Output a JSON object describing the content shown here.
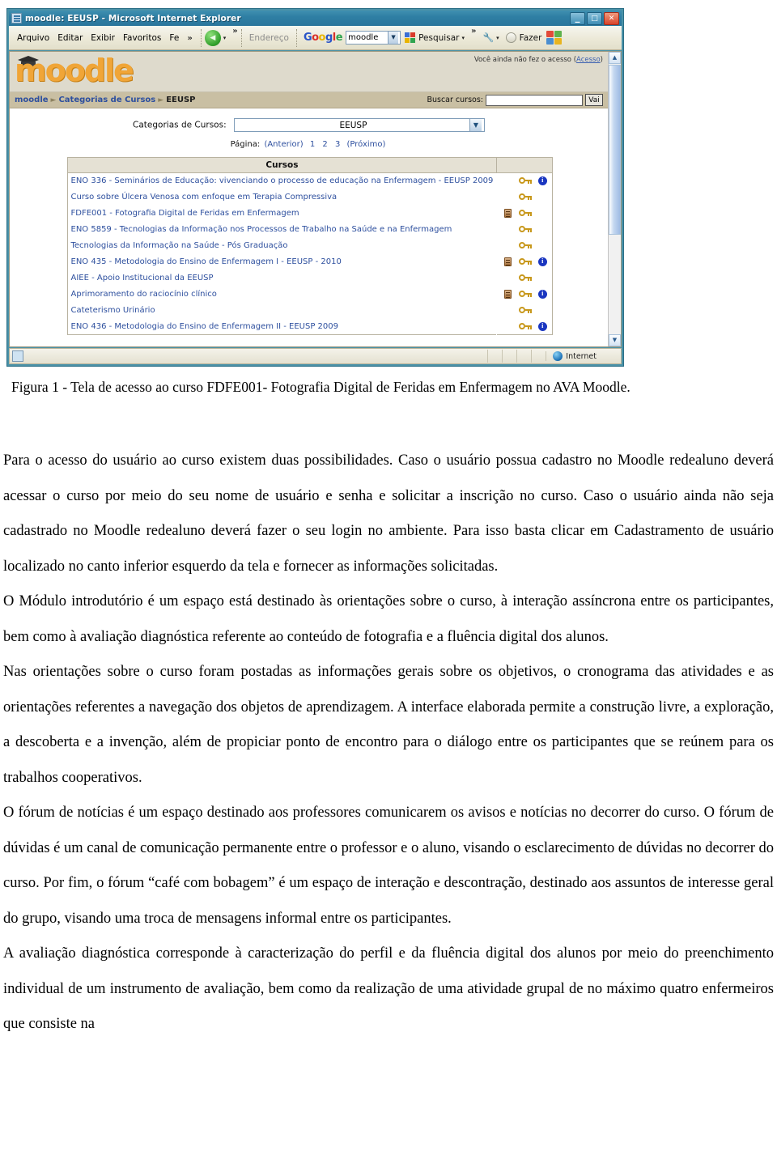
{
  "browser": {
    "window_title": "moodle: EEUSP - Microsoft Internet Explorer",
    "window_controls": {
      "minimize": "_",
      "maximize": "□",
      "close": "✕"
    },
    "menu_items": [
      "Arquivo",
      "Editar",
      "Exibir",
      "Favoritos",
      "Fe"
    ],
    "menu_overflow": "»",
    "nav_overflow": "»",
    "address_label": "Endereço",
    "google": {
      "logo": "Google",
      "query": "moodle",
      "search_label": "Pesquisar",
      "overflow": "»"
    },
    "tools_label": "Fazer",
    "status": {
      "zone": "Internet"
    }
  },
  "moodle": {
    "logo_text": "moodle",
    "login_note": "Você ainda não fez o acesso (",
    "login_link": "Acesso",
    "login_note_end": ")",
    "breadcrumb": [
      "moodle",
      "Categorias de Cursos",
      "EEUSP"
    ],
    "search": {
      "label": "Buscar cursos:",
      "value": "",
      "placeholder": "",
      "button": "Vai"
    },
    "category": {
      "label": "Categorias de Cursos:",
      "selected": "EEUSP"
    },
    "pager": {
      "label": "Página:",
      "prev": "(Anterior)",
      "pages": [
        "1",
        "2",
        "3"
      ],
      "next": "(Próximo)"
    },
    "table": {
      "header": "Cursos",
      "rows": [
        {
          "name": "ENO 336 - Seminários de Educação: vivenciando o processo de educação na Enfermagem - EEUSP 2009",
          "icons": [
            "key-icon",
            "info-icon"
          ]
        },
        {
          "name": "Curso sobre Úlcera Venosa com enfoque em Terapia Compressiva",
          "icons": [
            "key-icon"
          ]
        },
        {
          "name": "FDFE001 - Fotografia Digital de Feridas em Enfermagem",
          "icons": [
            "doc-icon",
            "key-icon"
          ]
        },
        {
          "name": "ENO 5859 - Tecnologias da Informação nos Processos de Trabalho na Saúde e na Enfermagem",
          "icons": [
            "key-icon"
          ]
        },
        {
          "name": "Tecnologias da Informação na Saúde - Pós Graduação",
          "icons": [
            "key-icon"
          ]
        },
        {
          "name": "ENO 435 - Metodologia do Ensino de Enfermagem I - EEUSP - 2010",
          "icons": [
            "doc-icon",
            "key-icon",
            "info-icon"
          ]
        },
        {
          "name": "AIEE - Apoio Institucional da EEUSP",
          "icons": [
            "key-icon"
          ]
        },
        {
          "name": "Aprimoramento do raciocínio clínico",
          "icons": [
            "doc-icon",
            "key-icon",
            "info-icon"
          ]
        },
        {
          "name": "Cateterismo Urinário",
          "icons": [
            "key-icon"
          ]
        },
        {
          "name": "ENO 436 - Metodologia do Ensino de Enfermagem II - EEUSP 2009",
          "icons": [
            "key-icon",
            "info-icon"
          ]
        }
      ]
    }
  },
  "document": {
    "figure_caption": "Figura 1 - Tela de acesso ao curso FDFE001- Fotografia Digital de Feridas em Enfermagem no AVA Moodle.",
    "paragraphs": [
      "Para o acesso do usuário ao curso existem duas possibilidades. Caso o usuário possua cadastro no Moodle redealuno deverá acessar o curso por meio do seu nome de usuário e senha e solicitar a inscrição no curso. Caso o usuário ainda não seja cadastrado no Moodle redealuno deverá fazer o seu login no ambiente. Para isso basta clicar em Cadastramento de usuário localizado no canto inferior esquerdo da tela e fornecer as informações solicitadas.",
      "O Módulo introdutório é um espaço está destinado às orientações sobre o curso, à interação assíncrona entre os participantes, bem como à avaliação diagnóstica referente ao conteúdo de fotografia e a fluência digital dos alunos.",
      "Nas orientações sobre o curso foram postadas as informações gerais sobre os objetivos, o cronograma das atividades e as orientações referentes a navegação dos objetos de aprendizagem. A interface elaborada permite a construção livre, a exploração, a descoberta e a invenção, além de propiciar ponto de encontro para o diálogo entre os participantes que se reúnem para os trabalhos cooperativos.",
      "O fórum de notícias é um espaço destinado aos professores comunicarem os avisos e notícias no decorrer do curso. O fórum de dúvidas é um canal de comunicação permanente entre o professor e o aluno, visando o esclarecimento de dúvidas no decorrer do curso. Por fim, o fórum “café com bobagem” é um espaço de interação e descontração, destinado aos assuntos de interesse geral do grupo, visando uma troca de mensagens informal entre os participantes.",
      "A avaliação diagnóstica corresponde à caracterização do perfil e da fluência digital dos alunos por meio do preenchimento individual de um instrumento de avaliação, bem como da realização de uma atividade grupal de no máximo quatro enfermeiros que consiste na"
    ]
  },
  "colors": {
    "window_frame": "#2c6f86",
    "titlebar": "#2f7fa4",
    "toolbar": "#ece9d8",
    "moodle_orange": "#f0a537",
    "moodle_header_bg": "#dedacc",
    "navbar_bg": "#c9bfa3",
    "link_blue": "#2d4f9e",
    "info_icon_blue": "#1a36c0",
    "key_icon_gold": "#c8981c"
  }
}
